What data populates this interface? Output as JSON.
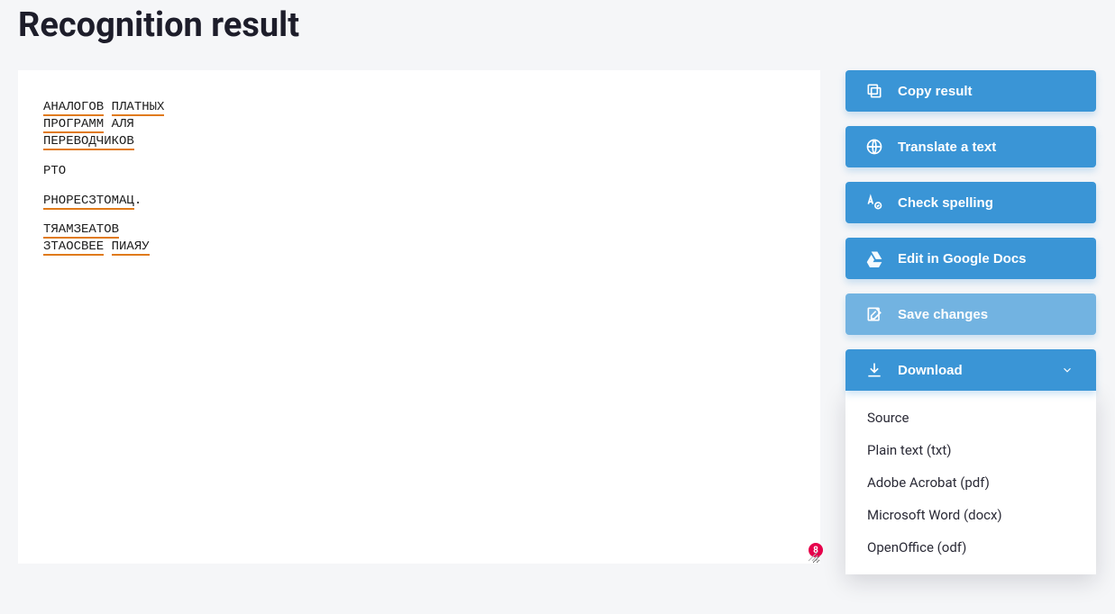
{
  "title": "Recognition result",
  "editor": {
    "lines": [
      [
        {
          "t": "АНАЛОГОВ",
          "hl": true
        },
        {
          "t": " "
        },
        {
          "t": "ПЛАТНЫХ",
          "hl": true
        }
      ],
      [
        {
          "t": "ПРОГРАММ",
          "hl": true
        },
        {
          "t": " АЛЯ"
        }
      ],
      [
        {
          "t": "ПЕРЕВОДЧИКОВ",
          "hl": true
        }
      ],
      null,
      [
        {
          "t": "РТО"
        }
      ],
      null,
      [
        {
          "t": "РНОРЕСЗТОМАЦ",
          "hl": true
        },
        {
          "t": "."
        }
      ],
      null,
      [
        {
          "t": "ТЯАМЗЕАТОВ",
          "hl": true
        }
      ],
      [
        {
          "t": "ЗТАОСВЕЕ",
          "hl": true
        },
        {
          "t": " "
        },
        {
          "t": "ПИАЯУ",
          "hl": true
        }
      ]
    ]
  },
  "badge_count": "8",
  "actions": {
    "copy": "Copy result",
    "translate": "Translate a text",
    "spell": "Check spelling",
    "gdocs": "Edit in Google Docs",
    "save": "Save changes",
    "download": "Download"
  },
  "download_options": [
    "Source",
    "Plain text (txt)",
    "Adobe Acrobat (pdf)",
    "Microsoft Word (docx)",
    "OpenOffice (odf)"
  ]
}
